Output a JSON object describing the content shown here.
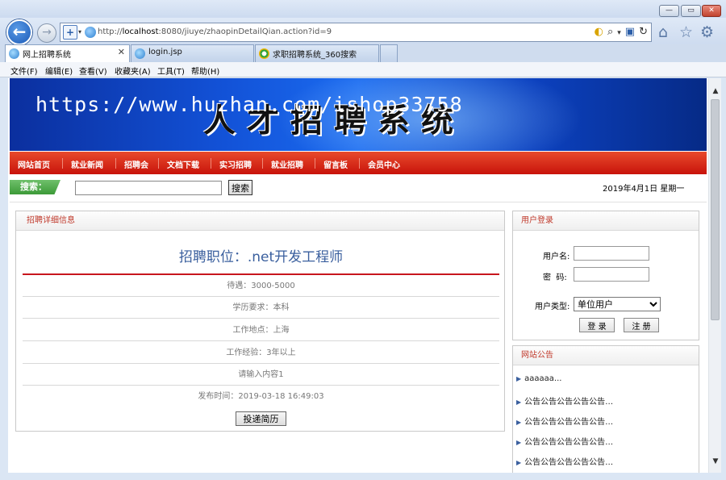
{
  "browser": {
    "address": {
      "host_prefix": "http://",
      "host": "localhost",
      "rest": ":8080/jiuye/zhaopinDetailQian.action?id=9"
    },
    "window_controls": {
      "minimize": "—",
      "maximize": "▭",
      "close": "✕"
    },
    "tabs": [
      {
        "label": "网上招聘系统",
        "active": true,
        "close": "✕"
      },
      {
        "label": "login.jsp",
        "active": false
      },
      {
        "label": "求职招聘系统_360搜索",
        "active": false
      }
    ],
    "menu": [
      "文件(F)",
      "编辑(E)",
      "查看(V)",
      "收藏夹(A)",
      "工具(T)",
      "帮助(H)"
    ]
  },
  "site": {
    "banner_title": "人才招聘系统",
    "watermark": "https://www.huzhan.com/ishop33758",
    "nav": [
      "网站首页",
      "就业新闻",
      "招聘会",
      "文档下载",
      "实习招聘",
      "就业招聘",
      "留言板",
      "会员中心"
    ],
    "search": {
      "label": "搜索：",
      "button": "搜索",
      "value": ""
    },
    "date": "2019年4月1日  星期一"
  },
  "detail": {
    "header": "招聘详细信息",
    "title": "招聘职位：.net开发工程师",
    "rows": [
      "待遇：3000-5000",
      "学历要求：本科",
      "工作地点：上海",
      "工作经验：3年以上",
      "请输入内容1",
      "发布时间：2019-03-18 16:49:03"
    ],
    "apply_button": "投递简历"
  },
  "login": {
    "header": "用户登录",
    "username_label": "用户名:",
    "password_label": "密  码:",
    "type_label": "用户类型:",
    "type_value": "单位用户",
    "login_button": "登 录",
    "register_button": "注 册"
  },
  "notices": {
    "header": "网站公告",
    "items": [
      "aaaaaa...",
      "公告公告公告公告公告…",
      "公告公告公告公告公告…",
      "公告公告公告公告公告…",
      "公告公告公告公告公告…"
    ]
  }
}
